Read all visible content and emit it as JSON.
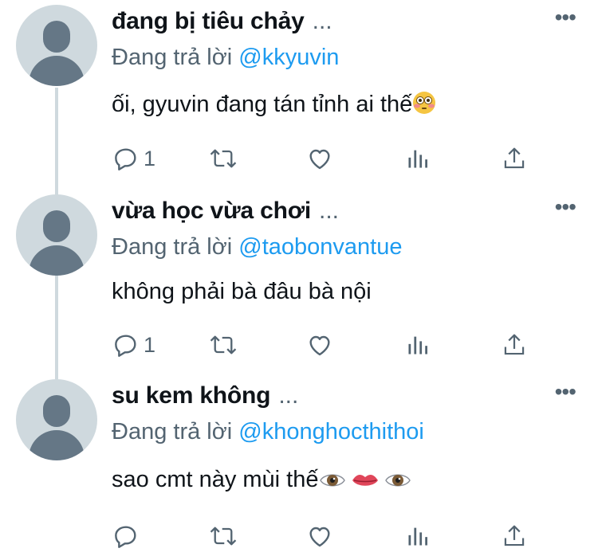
{
  "thread": [
    {
      "name": "đang bị tiêu chảy",
      "name_suffix": "...",
      "more_label": "•••",
      "reply_prefix": "Đang trả lời",
      "reply_handle": "@kkyuvin",
      "text": "ối, gyuvin đang tán tỉnh ai thế",
      "emojis": [
        "flushed-face"
      ],
      "reply_count": "1"
    },
    {
      "name": "vừa học vừa chơi",
      "name_suffix": "...",
      "more_label": "•••",
      "reply_prefix": "Đang trả lời",
      "reply_handle": "@taobonvantue",
      "text": "không phải bà đâu bà nội",
      "emojis": [],
      "reply_count": "1"
    },
    {
      "name": "su kem không",
      "name_suffix": "...",
      "more_label": "•••",
      "reply_prefix": "Đang trả lời",
      "reply_handle": "@khonghocthithoi",
      "text": "sao cmt này mùi thế",
      "emojis": [
        "eye",
        "mouth",
        "eye"
      ],
      "reply_count": ""
    }
  ],
  "colors": {
    "text": "#0f1419",
    "secondary": "#536471",
    "link": "#1d9bf0",
    "avatar_bg": "#cfd9de",
    "avatar_fg": "#657786"
  }
}
